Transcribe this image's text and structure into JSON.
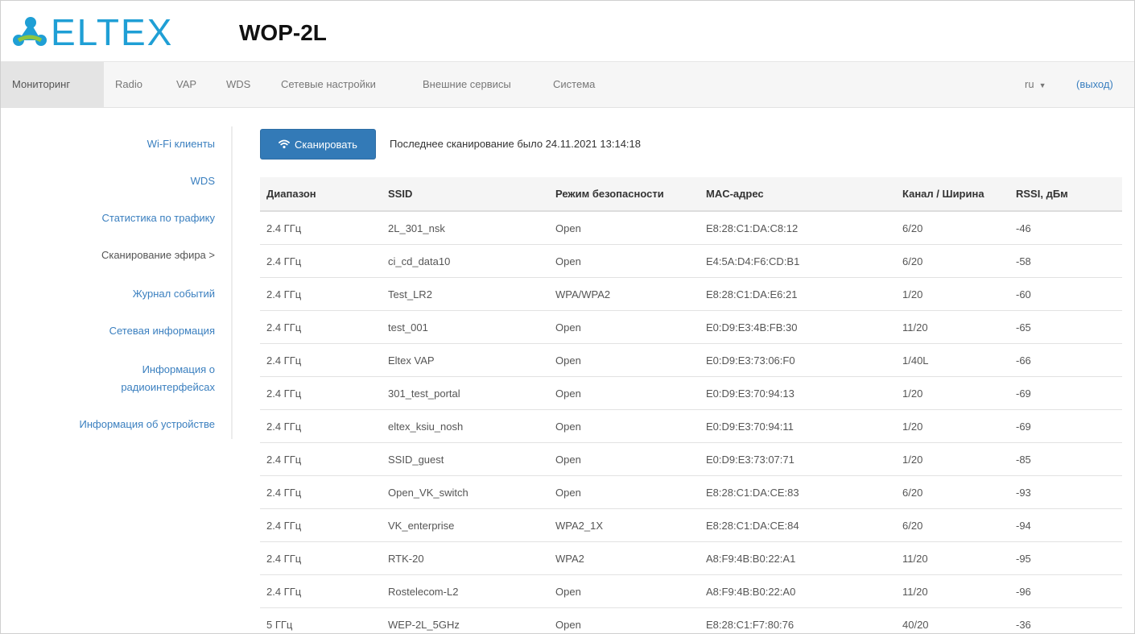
{
  "header": {
    "logo_text": "ELTEX",
    "product": "WOP-2L"
  },
  "nav": {
    "items": [
      {
        "label": "Мониторинг",
        "active": true
      },
      {
        "label": "Radio"
      },
      {
        "label": "VAP"
      },
      {
        "label": "WDS"
      },
      {
        "label": "Сетевые настройки"
      },
      {
        "label": "Внешние сервисы"
      },
      {
        "label": "Система"
      }
    ],
    "lang": "ru",
    "logout": "(выход)"
  },
  "sidebar": {
    "items": [
      {
        "label": "Wi-Fi клиенты"
      },
      {
        "label": "WDS"
      },
      {
        "label": "Статистика по трафику"
      },
      {
        "label": "Сканирование эфира >",
        "current": true
      },
      {
        "label": "Журнал событий"
      },
      {
        "label": "Сетевая информация"
      },
      {
        "label": "Информация о"
      },
      {
        "label": "радиоинтерфейсах"
      },
      {
        "label": "Информация об устройстве"
      }
    ]
  },
  "scan": {
    "button_label": "Сканировать",
    "last_scan": "Последнее сканирование было 24.11.2021 13:14:18"
  },
  "table": {
    "headers": [
      "Диапазон",
      "SSID",
      "Режим безопасности",
      "MAC-адрес",
      "Канал / Ширина",
      "RSSI, дБм"
    ],
    "rows": [
      [
        "2.4 ГГц",
        "2L_301_nsk",
        "Open",
        "E8:28:C1:DA:C8:12",
        "6/20",
        "-46"
      ],
      [
        "2.4 ГГц",
        "ci_cd_data10",
        "Open",
        "E4:5A:D4:F6:CD:B1",
        "6/20",
        "-58"
      ],
      [
        "2.4 ГГц",
        "Test_LR2",
        "WPA/WPA2",
        "E8:28:C1:DA:E6:21",
        "1/20",
        "-60"
      ],
      [
        "2.4 ГГц",
        "test_001",
        "Open",
        "E0:D9:E3:4B:FB:30",
        "11/20",
        "-65"
      ],
      [
        "2.4 ГГц",
        "Eltex VAP",
        "Open",
        "E0:D9:E3:73:06:F0",
        "1/40L",
        "-66"
      ],
      [
        "2.4 ГГц",
        "301_test_portal",
        "Open",
        "E0:D9:E3:70:94:13",
        "1/20",
        "-69"
      ],
      [
        "2.4 ГГц",
        "eltex_ksiu_nosh",
        "Open",
        "E0:D9:E3:70:94:11",
        "1/20",
        "-69"
      ],
      [
        "2.4 ГГц",
        "SSID_guest",
        "Open",
        "E0:D9:E3:73:07:71",
        "1/20",
        "-85"
      ],
      [
        "2.4 ГГц",
        "Open_VK_switch",
        "Open",
        "E8:28:C1:DA:CE:83",
        "6/20",
        "-93"
      ],
      [
        "2.4 ГГц",
        "VK_enterprise",
        "WPA2_1X",
        "E8:28:C1:DA:CE:84",
        "6/20",
        "-94"
      ],
      [
        "2.4 ГГц",
        "RTK-20",
        "WPA2",
        "A8:F9:4B:B0:22:A1",
        "11/20",
        "-95"
      ],
      [
        "2.4 ГГц",
        "Rostelecom-L2",
        "Open",
        "A8:F9:4B:B0:22:A0",
        "11/20",
        "-96"
      ],
      [
        "5 ГГц",
        "WEP-2L_5GHz",
        "Open",
        "E8:28:C1:F7:80:76",
        "40/20",
        "-36"
      ]
    ]
  },
  "icons": {
    "logo": "eltex-logo-icon",
    "scan": "wifi-icon",
    "lang": "caret-down-icon"
  },
  "colors": {
    "brand": "#1f9fd5",
    "primary_button": "#337ab7",
    "link": "#3a7fbf"
  }
}
